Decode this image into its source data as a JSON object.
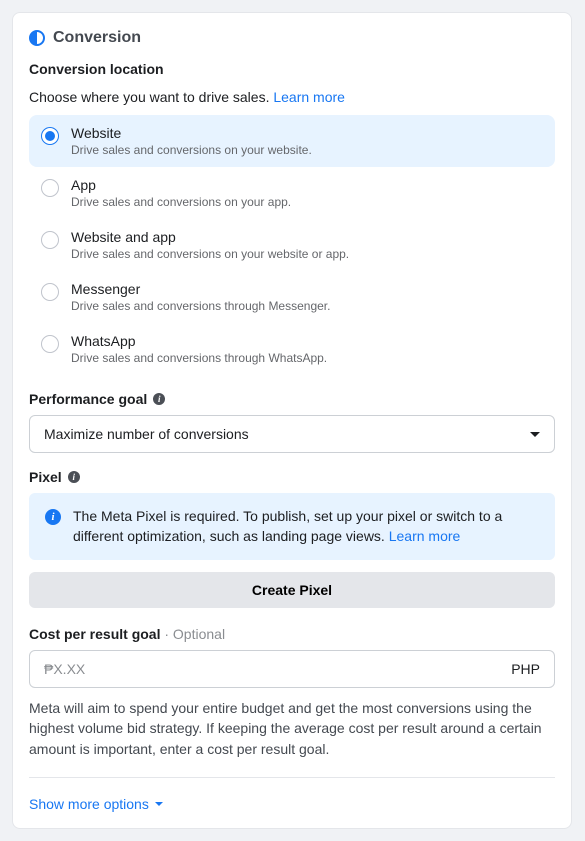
{
  "section": {
    "title": "Conversion",
    "location": {
      "heading": "Conversion location",
      "helper": "Choose where you want to drive sales.",
      "learn_more": "Learn more",
      "options": [
        {
          "label": "Website",
          "desc": "Drive sales and conversions on your website.",
          "selected": true
        },
        {
          "label": "App",
          "desc": "Drive sales and conversions on your app.",
          "selected": false
        },
        {
          "label": "Website and app",
          "desc": "Drive sales and conversions on your website or app.",
          "selected": false
        },
        {
          "label": "Messenger",
          "desc": "Drive sales and conversions through Messenger.",
          "selected": false
        },
        {
          "label": "WhatsApp",
          "desc": "Drive sales and conversions through WhatsApp.",
          "selected": false
        }
      ]
    }
  },
  "performance_goal": {
    "label": "Performance goal",
    "value": "Maximize number of conversions"
  },
  "pixel": {
    "label": "Pixel",
    "banner_text": "The Meta Pixel is required. To publish, set up your pixel or switch to a different optimization, such as landing page views.",
    "banner_learn_more": "Learn more",
    "create_button": "Create Pixel"
  },
  "cost_goal": {
    "label": "Cost per result goal",
    "optional": "· Optional",
    "placeholder": "₱X.XX",
    "currency": "PHP",
    "help": "Meta will aim to spend your entire budget and get the most conversions using the highest volume bid strategy. If keeping the average cost per result around a certain amount is important, enter a cost per result goal."
  },
  "show_more": "Show more options"
}
